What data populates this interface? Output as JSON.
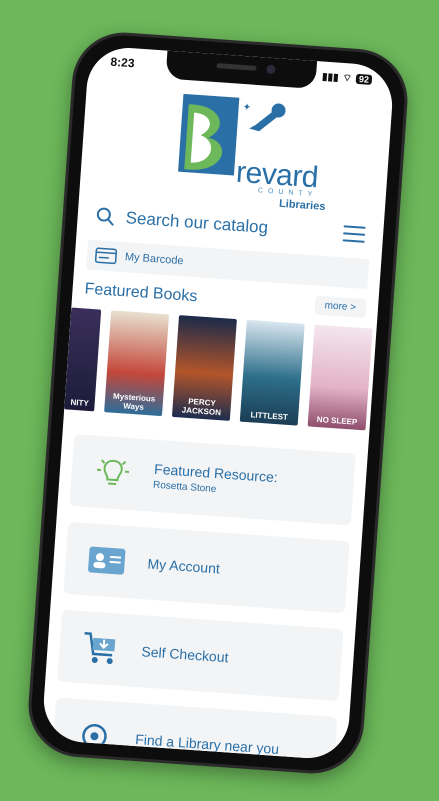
{
  "status_bar": {
    "time": "8:23",
    "battery": "92"
  },
  "logo": {
    "word": "revard",
    "county": "COUNTY",
    "libraries": "Libraries"
  },
  "search": {
    "placeholder": "Search our catalog"
  },
  "barcode": {
    "label": "My Barcode"
  },
  "featured": {
    "title": "Featured Books",
    "more_label": "more >",
    "books": [
      {
        "caption": "NITY"
      },
      {
        "caption": "Mysterious Ways"
      },
      {
        "caption": "PERCY JACKSON"
      },
      {
        "caption": "LITTLEST"
      },
      {
        "caption": "NO SLEEP"
      }
    ]
  },
  "cards": [
    {
      "title": "Featured Resource:",
      "subtitle": "Rosetta Stone",
      "icon": "lightbulb-icon"
    },
    {
      "title": "My Account",
      "icon": "id-card-icon"
    },
    {
      "title": "Self Checkout",
      "icon": "cart-icon"
    },
    {
      "title": "Find a Library near you",
      "icon": "location-icon"
    }
  ],
  "colors": {
    "brand_blue": "#2a6fa6",
    "brand_green": "#6cb85a"
  }
}
